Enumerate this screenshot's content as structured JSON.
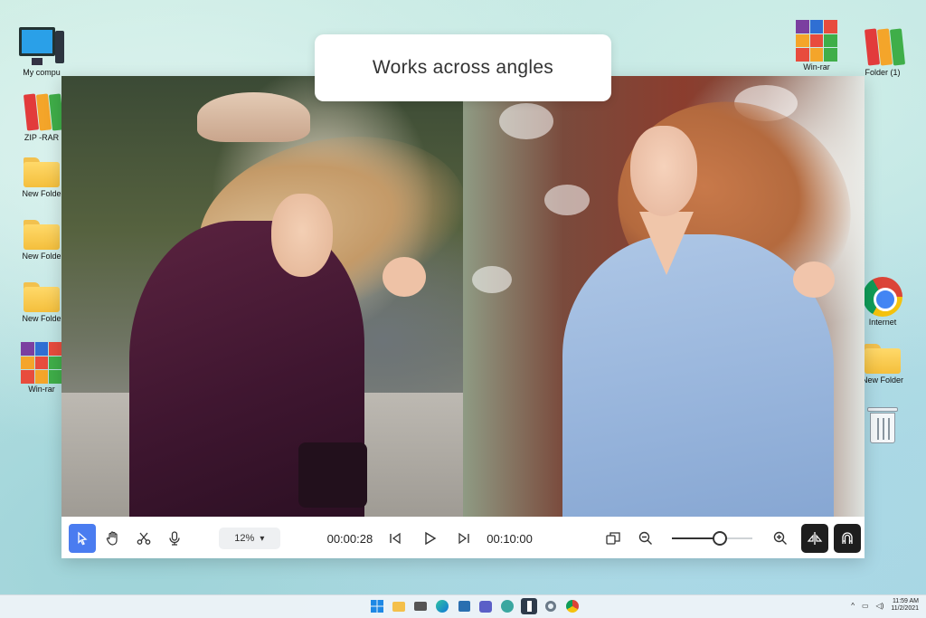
{
  "desktop": {
    "left_icons": [
      {
        "label": "My compu",
        "icon": "computer-icon"
      },
      {
        "label": "ZIP -RAR",
        "icon": "archive-binders-icon"
      },
      {
        "label": "New Folde",
        "icon": "folder-icon"
      },
      {
        "label": "New Folde",
        "icon": "folder-icon"
      },
      {
        "label": "New Folde",
        "icon": "folder-icon"
      },
      {
        "label": "Win-rar",
        "icon": "winrar-icon"
      }
    ],
    "right_icons": [
      {
        "label": "Win-rar",
        "icon": "winrar-icon"
      },
      {
        "label": "Folder (1)",
        "icon": "archive-binders-icon"
      },
      {
        "label": "Internet",
        "icon": "chrome-icon"
      },
      {
        "label": "New Folder",
        "icon": "folder-icon"
      },
      {
        "label": "",
        "icon": "recycle-bin-icon"
      }
    ]
  },
  "caption": "Works across angles",
  "editor": {
    "toolbar": {
      "tools": [
        "select-arrow-icon",
        "hand-icon",
        "scissors-icon",
        "microphone-icon"
      ],
      "zoom_value": "12%",
      "current_time": "00:00:28",
      "total_time": "00:10:00",
      "zoom_slider_level": 0.6
    }
  },
  "taskbar": {
    "apps": [
      "windows-start-icon",
      "file-explorer-icon",
      "camera-icon",
      "edge-icon",
      "store-icon",
      "teams-icon",
      "maps-icon",
      "editor-app-icon",
      "settings-icon",
      "chrome-icon"
    ],
    "time": "11:59 AM",
    "date": "11/2/2021"
  },
  "colors": {
    "accent": "#4a7cf0",
    "dark_button": "#1e1e1e"
  }
}
